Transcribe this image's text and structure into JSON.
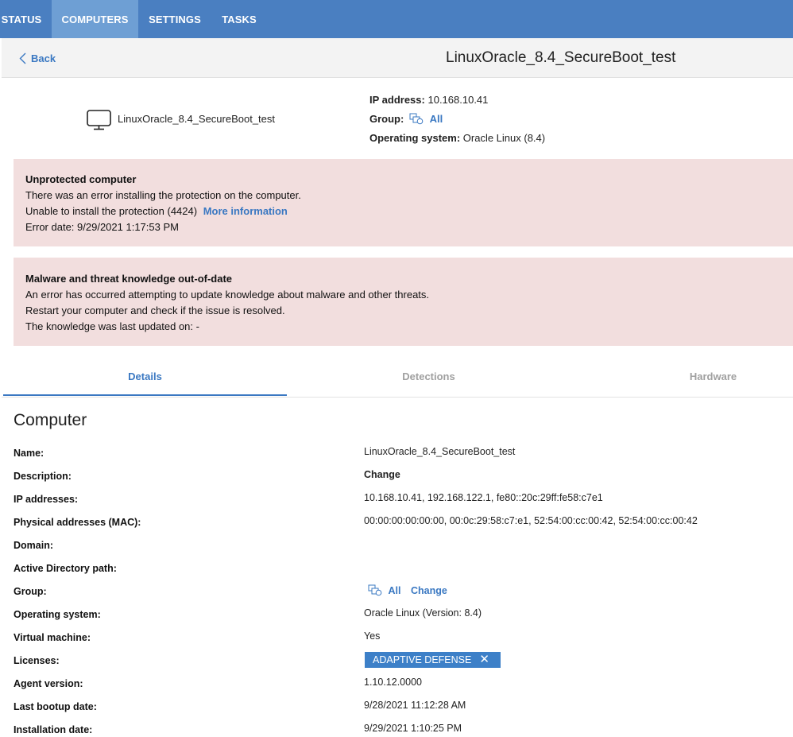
{
  "nav": {
    "tabs": [
      {
        "label": "STATUS"
      },
      {
        "label": "COMPUTERS"
      },
      {
        "label": "SETTINGS"
      },
      {
        "label": "TASKS"
      }
    ],
    "active": "COMPUTERS"
  },
  "header": {
    "back_label": "Back",
    "title": "LinuxOracle_8.4_SecureBoot_test"
  },
  "summary": {
    "computer_name": "LinuxOracle_8.4_SecureBoot_test",
    "ip_label": "IP address:",
    "ip_value": "10.168.10.41",
    "group_label": "Group:",
    "group_value": "All",
    "os_label": "Operating system:",
    "os_value": "Oracle Linux (8.4)"
  },
  "alerts": [
    {
      "title": "Unprotected computer",
      "line1": "There was an error installing the protection on the computer.",
      "line2": "Unable to install the protection (4424)",
      "link": "More information",
      "line3": "Error date: 9/29/2021 1:17:53 PM"
    },
    {
      "title": "Malware and threat knowledge out-of-date",
      "line1": "An error has occurred attempting to update knowledge about malware and other threats.",
      "line2": "Restart your computer and check if the issue is resolved.",
      "line3": "The knowledge was last updated on: -"
    }
  ],
  "panel_tabs": [
    {
      "label": "Details"
    },
    {
      "label": "Detections"
    },
    {
      "label": "Hardware"
    }
  ],
  "details": {
    "section_title": "Computer",
    "rows": [
      {
        "label": "Name:",
        "value": "LinuxOracle_8.4_SecureBoot_test"
      },
      {
        "label": "Description:",
        "value": "Change"
      },
      {
        "label": "IP addresses:",
        "value": "10.168.10.41, 192.168.122.1, fe80::20c:29ff:fe58:c7e1"
      },
      {
        "label": "Physical addresses (MAC):",
        "value": "00:00:00:00:00:00, 00:0c:29:58:c7:e1, 52:54:00:cc:00:42, 52:54:00:cc:00:42"
      },
      {
        "label": "Domain:",
        "value": ""
      },
      {
        "label": "Active Directory path:",
        "value": ""
      },
      {
        "label": "Group:",
        "value": "All",
        "action": "Change"
      },
      {
        "label": "Operating system:",
        "value": "Oracle Linux (Version: 8.4)"
      },
      {
        "label": "Virtual machine:",
        "value": "Yes"
      },
      {
        "label": "Licenses:",
        "value": "ADAPTIVE DEFENSE"
      },
      {
        "label": "Agent version:",
        "value": "1.10.12.0000"
      },
      {
        "label": "Last bootup date:",
        "value": "9/28/2021 11:12:28 AM"
      },
      {
        "label": "Installation date:",
        "value": "9/29/2021 1:10:25 PM"
      }
    ]
  },
  "icons": {
    "back": "chevron-left-icon",
    "computer": "monitor-icon",
    "group": "group-icon",
    "license_remove": "close-icon"
  },
  "colors": {
    "nav_bg": "#4a7fc1",
    "nav_active": "#6e9fd4",
    "link": "#3a78c2",
    "alert_bg": "#f2dede",
    "badge_bg": "#3d80c8"
  }
}
